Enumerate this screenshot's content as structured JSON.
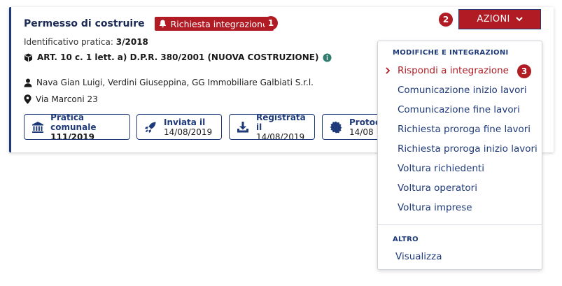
{
  "card": {
    "title": "Permesso di costruire",
    "tag": "Richiesta integrazione",
    "badge1": "1",
    "id_label": "Identificativo pratica:",
    "id_value": "3/2018",
    "article": "ART. 10 c. 1 lett. a) D.P.R. 380/2001 (NUOVA COSTRUZIONE)",
    "people": "Nava Gian Luigi, Verdini Giuseppina, GG Immobiliare Galbiati S.r.l.",
    "address": "Via Marconi 23",
    "chips": [
      {
        "label": "Pratica comunale",
        "value": "111/2019",
        "icon": "bank-icon"
      },
      {
        "label": "Inviata il",
        "value": "14/08/2019",
        "icon": "rocket-icon"
      },
      {
        "label": "Registrata il",
        "value": "14/08/2019",
        "icon": "download-tray-icon"
      },
      {
        "label": "Protoc",
        "value": "14/08",
        "icon": "seal-icon"
      }
    ]
  },
  "actions": {
    "badge2": "2",
    "button_label": "AZIONI",
    "menu": {
      "section1": "MODIFICHE E INTEGRAZIONI",
      "badge3": "3",
      "items": [
        "Rispondi a integrazione",
        "Comunicazione inizio lavori",
        "Comunicazione fine lavori",
        "Richiesta proroga fine lavori",
        "Richiesta proroga inizio lavori",
        "Voltura richiedenti",
        "Voltura operatori",
        "Voltura imprese"
      ],
      "section2": "ALTRO",
      "other_items": [
        "Visualizza"
      ]
    }
  },
  "colors": {
    "primary": "#1f3a7a",
    "danger": "#b01b24"
  }
}
